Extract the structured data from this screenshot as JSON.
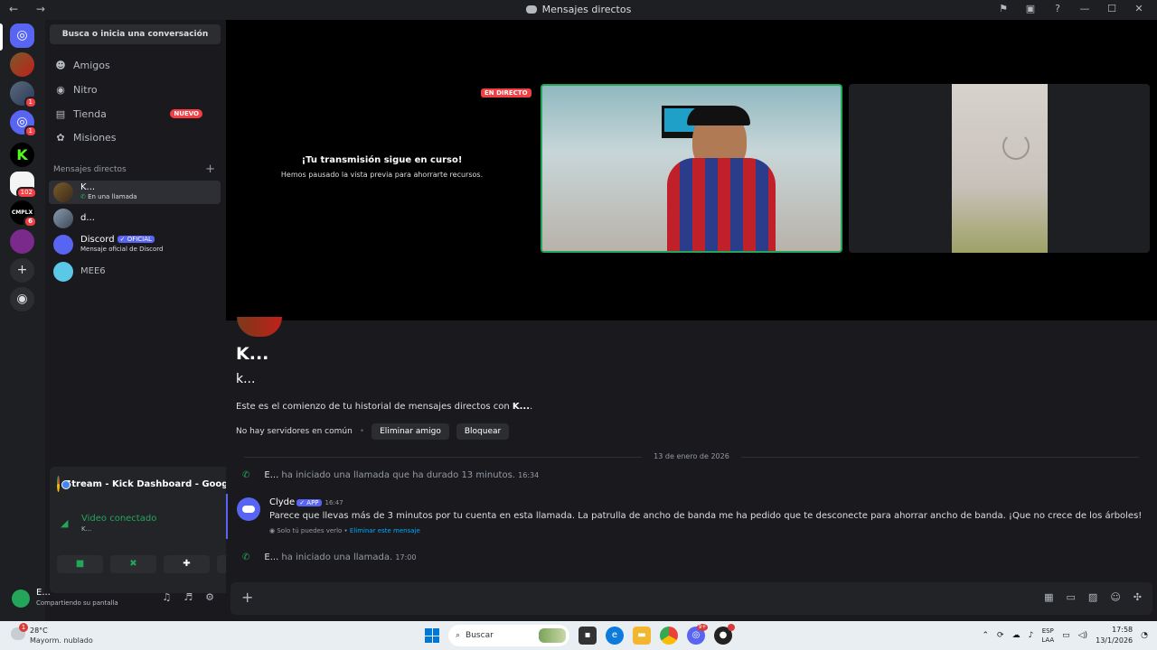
{
  "window": {
    "title": "Mensajes directos",
    "nav": "← →"
  },
  "titlebar_icons": [
    "inbox-flag-icon",
    "screen-share-icon",
    "help-icon",
    "minimize-icon",
    "maximize-icon",
    "close-icon"
  ],
  "titlebar_glyphs": [
    "⚑",
    "▣",
    "?",
    "—",
    "☐",
    "✕"
  ],
  "servers": [
    {
      "name": "home-discord",
      "badge": ""
    },
    {
      "name": "server-1",
      "badge": ""
    },
    {
      "name": "server-2",
      "badge": "1"
    },
    {
      "name": "server-3",
      "badge": "1"
    },
    {
      "name": "server-kick",
      "badge": ""
    },
    {
      "name": "server-5",
      "badge": "102"
    },
    {
      "name": "server-complex",
      "badge": "6"
    },
    {
      "name": "server-7",
      "badge": ""
    }
  ],
  "sidebar": {
    "search": "Busca o inicia una conversación",
    "items": [
      {
        "label": "Amigos",
        "icon": "friends-icon",
        "glyph": "☻"
      },
      {
        "label": "Nitro",
        "icon": "nitro-icon",
        "glyph": "◉"
      },
      {
        "label": "Tienda",
        "icon": "shop-icon",
        "glyph": "▤",
        "badge": "NUEVO"
      },
      {
        "label": "Misiones",
        "icon": "quests-icon",
        "glyph": "✿"
      }
    ],
    "dm_header": "Mensajes directos",
    "dms": [
      {
        "name": "K...",
        "sub": "En una llamada"
      },
      {
        "name": "d...",
        "sub": ""
      },
      {
        "name": "Discord",
        "badge": "OFICIAL",
        "sub": "Mensaje oficial de Discord"
      },
      {
        "name": "MEE6",
        "sub": ""
      }
    ]
  },
  "voice_panel": {
    "stream_title": "Stream - Kick Dashboard - Google ...",
    "status": "Video conectado",
    "channel": "K...",
    "buttons": [
      "■",
      "✖",
      "✚",
      "✦"
    ]
  },
  "user": {
    "name": "E...",
    "status": "Compartiendo su pantalla"
  },
  "video": {
    "live_badge": "EN DIRECTO",
    "paused_title": "¡Tu transmisión sigue en curso!",
    "paused_sub": "Hemos pausado la vista previa para ahorrarte recursos."
  },
  "chat": {
    "name": "K...",
    "username": "k...",
    "beginning_prefix": "Este es el comienzo de tu historial de mensajes directos con ",
    "beginning_name": "K...",
    "beginning_suffix": ".",
    "no_servers": "No hay servidores en común",
    "remove_friend": "Eliminar amigo",
    "block": "Bloquear",
    "date_divider": "13 de enero de 2026",
    "call1": {
      "user": "E...",
      "text": " ha iniciado una llamada que ha durado 13 minutos.",
      "time": "16:34"
    },
    "clyde": {
      "name": "Clyde",
      "tag": "APP",
      "time": "16:47",
      "body": "Parece que llevas más de 3 minutos por tu cuenta en esta llamada. La patrulla de ancho de banda me ha pedido que te desconecte para ahorrar ancho de banda. ¡Que no crece de los árboles!",
      "ephemeral": "Solo tú puedes verlo",
      "dismiss": "Eliminar este mensaje"
    },
    "call2": {
      "user": "E...",
      "text": " ha iniciado una llamada.",
      "time": "17:00"
    }
  },
  "taskbar": {
    "temp": "28°C",
    "weather": "Mayorm. nublado",
    "weather_badge": "1",
    "search": "Buscar",
    "discord_badge": "9+",
    "lang1": "ESP",
    "lang2": "LAA",
    "time": "17:58",
    "date": "13/1/2026"
  },
  "colors": {
    "accent": "#5865f2",
    "green": "#23a55a",
    "red": "#f23f43"
  }
}
